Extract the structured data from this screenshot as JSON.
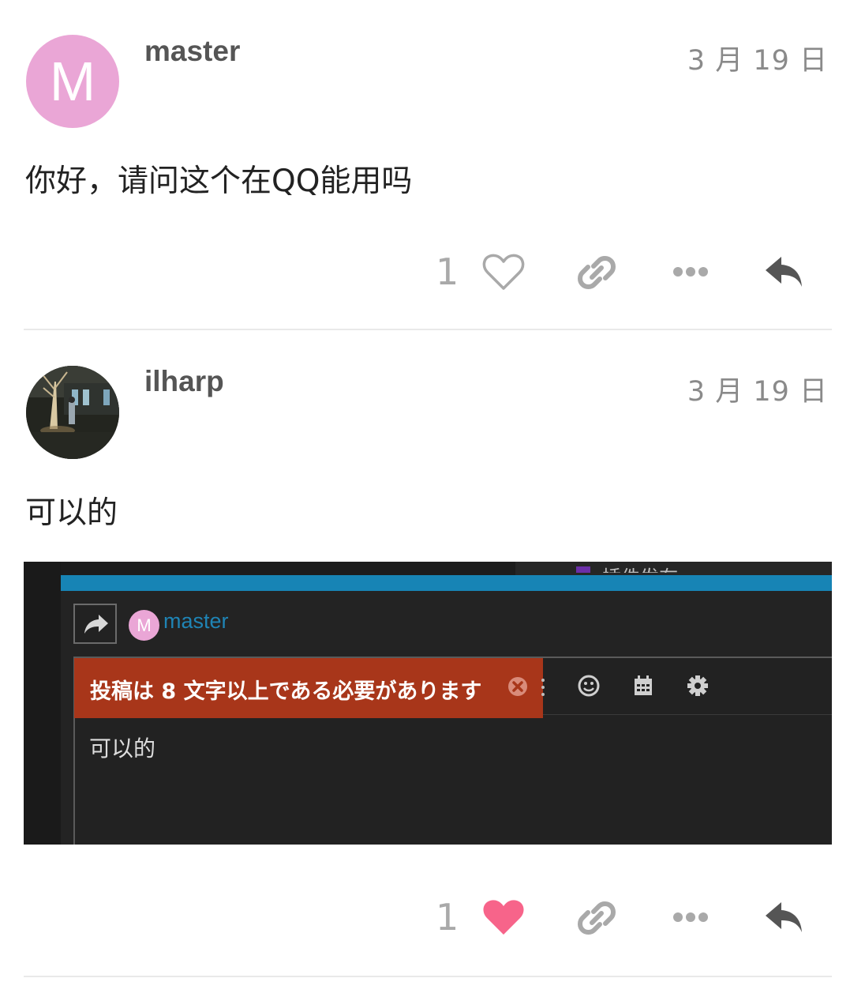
{
  "posts": [
    {
      "username": "master",
      "avatar_letter": "M",
      "avatar_color": "#eaa6d6",
      "date": "3 月 19 日",
      "content": "你好，请问这个在QQ能用吗",
      "like_count": "1",
      "liked": false
    },
    {
      "username": "ilharp",
      "avatar": "photo-avatar",
      "date": "3 月 19 日",
      "content": "可以的",
      "like_count": "1",
      "liked": true,
      "screenshot": {
        "top_cut_text": "插件发布",
        "reply_user": "master",
        "reply_avatar_letter": "M",
        "error_message": "投稿は 8 文字以上である必要があります",
        "editor_text": "可以的",
        "accent_color": "#1784b5",
        "error_color": "#a8361a"
      }
    }
  ],
  "icons": {
    "like": "heart-icon",
    "link": "link-icon",
    "more": "more-icon",
    "reply": "reply-icon"
  },
  "colors": {
    "liked_heart": "#f7648a",
    "icon_gray": "#a9a9a9",
    "reply_icon": "#555555"
  }
}
